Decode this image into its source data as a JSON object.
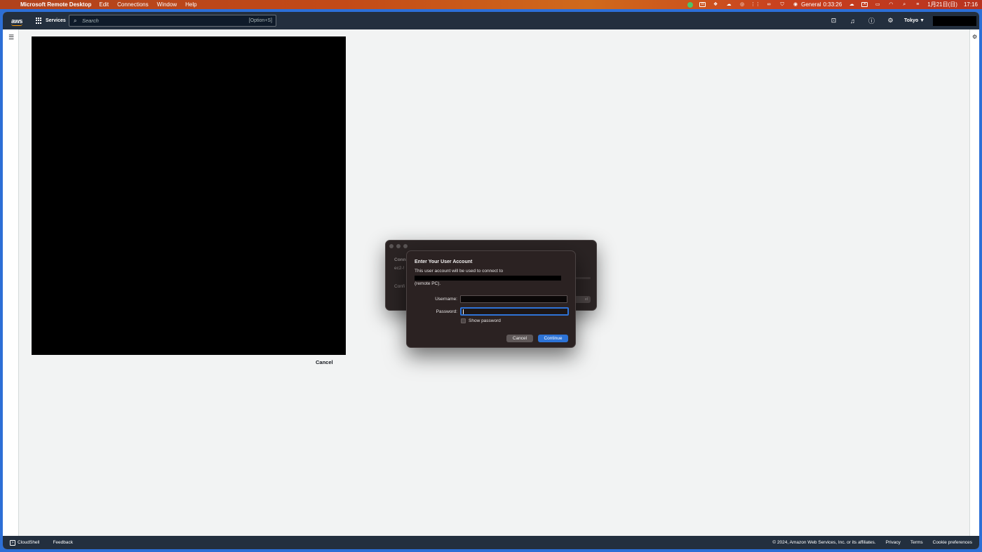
{
  "menubar": {
    "app_name": "Microsoft Remote Desktop",
    "items": [
      "Edit",
      "Connections",
      "Window",
      "Help"
    ],
    "focus_label": "General",
    "timer": "0:33:26",
    "date": "1月21日(日)",
    "time": "17:16",
    "input_indicator": "A"
  },
  "aws": {
    "logo_text": "aws",
    "services_label": "Services",
    "search_placeholder": "Search",
    "search_shortcut": "[Option+S]",
    "region": "Tokyo ▼",
    "bg_cancel_label": "Cancel"
  },
  "back_dialog": {
    "line1": "Conn",
    "line2": "ec2-!",
    "line3": "Confi",
    "button_fragment": "el"
  },
  "login_dialog": {
    "title": "Enter Your User Account",
    "description": "This user account will be used to connect to",
    "remote_suffix": "(remote PC).",
    "username_label": "Username:",
    "password_label": "Password:",
    "username_value": "",
    "password_value": "",
    "show_password_label": "Show password",
    "show_password_checked": false,
    "cancel_label": "Cancel",
    "continue_label": "Continue"
  },
  "footer": {
    "cloudshell": "CloudShell",
    "feedback": "Feedback",
    "copyright": "© 2024, Amazon Web Services, Inc. or its affiliates.",
    "privacy": "Privacy",
    "terms": "Terms",
    "cookie": "Cookie preferences"
  },
  "colors": {
    "aws_navy": "#232f3e",
    "aws_orange": "#ff9900",
    "mac_accent_blue": "#2d73d6",
    "dialog_bg": "#2b2222"
  }
}
